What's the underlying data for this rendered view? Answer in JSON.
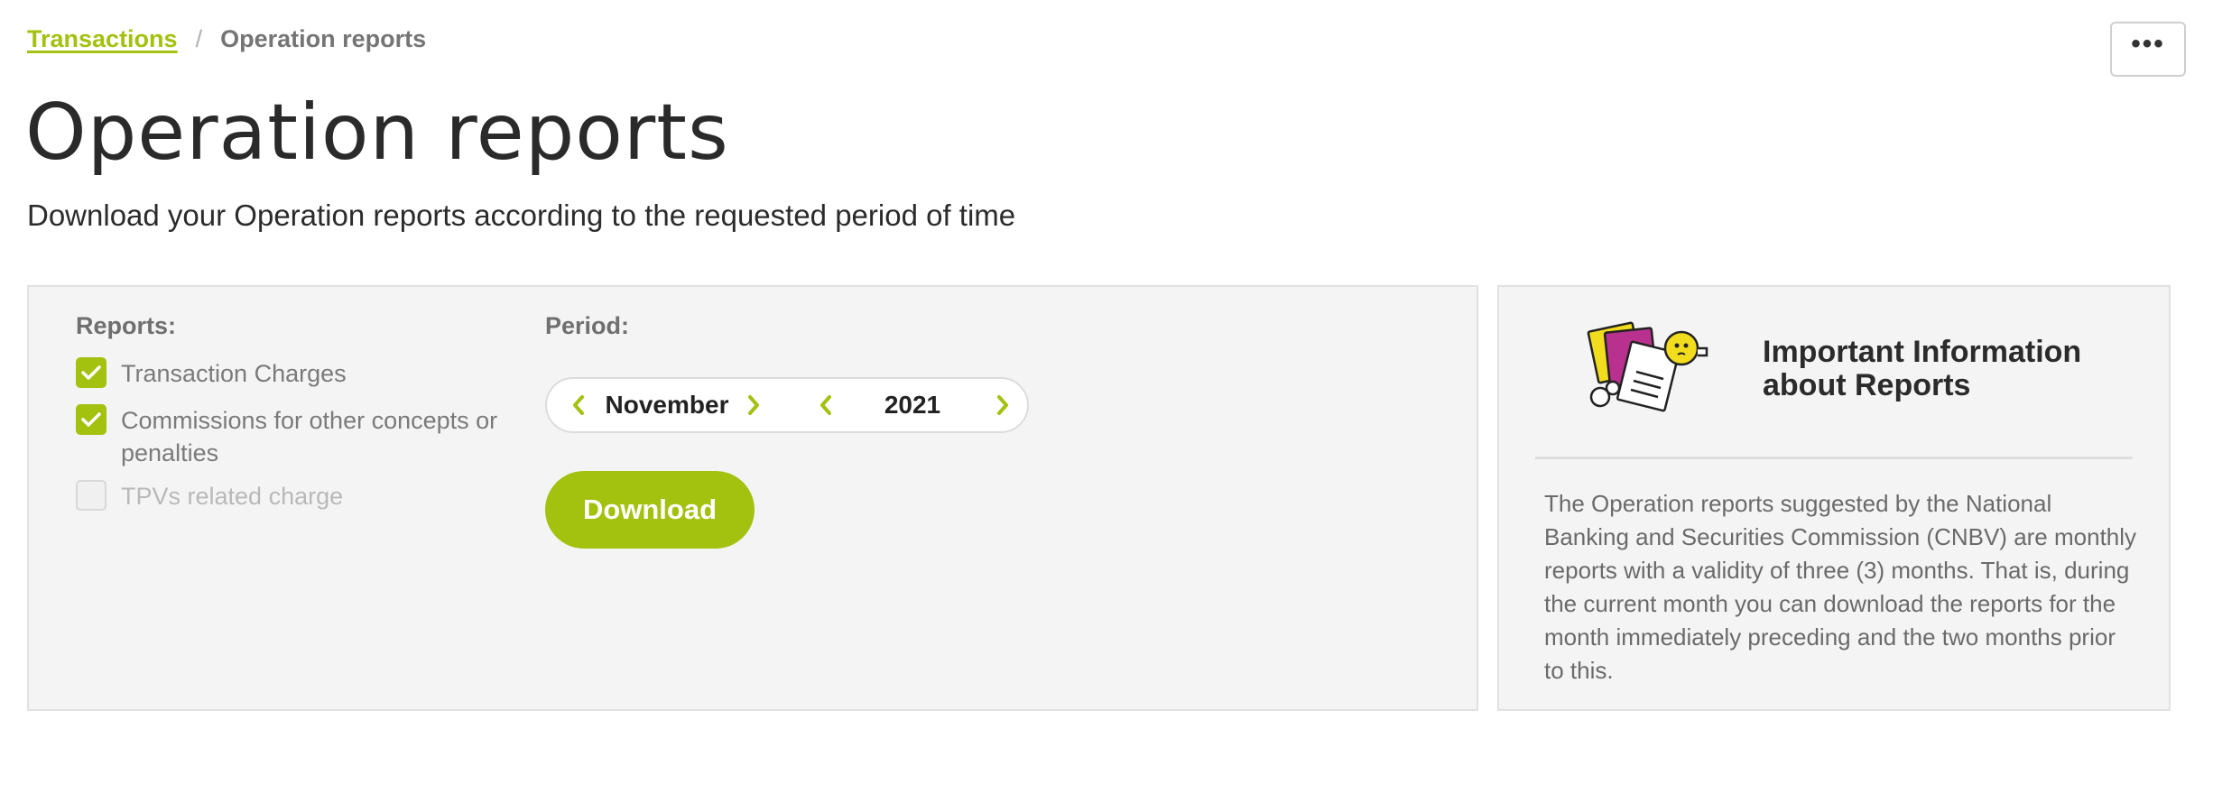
{
  "breadcrumb": {
    "parent": "Transactions",
    "separator": "/",
    "current": "Operation reports"
  },
  "header": {
    "more_label": "•••",
    "title": "Operation reports",
    "subtitle": "Download your Operation reports according to the requested period of time"
  },
  "reports": {
    "label": "Reports:",
    "options": [
      {
        "label": "Transaction Charges",
        "checked": true,
        "enabled": true
      },
      {
        "label": "Commissions for other concepts or penalties",
        "checked": true,
        "enabled": true
      },
      {
        "label": "TPVs related charge",
        "checked": false,
        "enabled": false
      }
    ]
  },
  "period": {
    "label": "Period:",
    "month": "November",
    "year": "2021"
  },
  "download_label": "Download",
  "info": {
    "title": "Important Information about Reports",
    "text": "The Operation reports suggested by the National Banking and Securities Commission (CNBV) are monthly reports with a validity of three (3) months. That is, during the current month you can download the reports for the month immediately preceding and the two months prior to this."
  },
  "colors": {
    "accent": "#a3c10f",
    "panel_bg": "#f4f4f4",
    "text_dark": "#2b2b2b",
    "text_muted": "#7a7a7a"
  }
}
